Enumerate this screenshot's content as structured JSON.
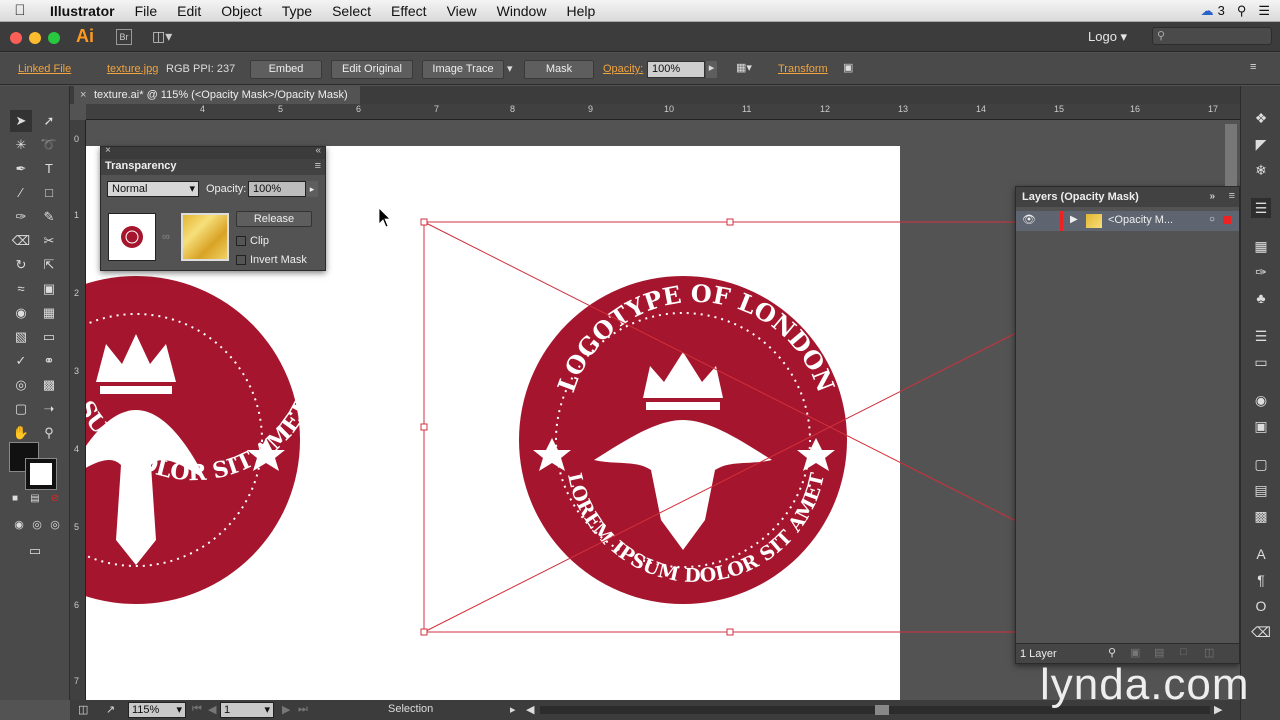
{
  "menubar": {
    "app_name": "Illustrator",
    "items": [
      "File",
      "Edit",
      "Object",
      "Type",
      "Select",
      "Effect",
      "View",
      "Window",
      "Help"
    ],
    "notification_count": "3"
  },
  "appbar": {
    "app_logo": "Ai",
    "bridge": "Br",
    "workspace": "Logo"
  },
  "control_bar": {
    "linked_file": "Linked File",
    "filename": "texture.jpg",
    "color_mode": "RGB",
    "ppi": "PPI: 237",
    "embed": "Embed",
    "edit_original": "Edit Original",
    "image_trace": "Image Trace",
    "mask": "Mask",
    "opacity_label": "Opacity:",
    "opacity_value": "100%",
    "transform": "Transform"
  },
  "document": {
    "tab_title": "texture.ai* @ 115% (<Opacity Mask>/Opacity Mask)"
  },
  "rulers": {
    "h_numbers": [
      "4",
      "5",
      "6",
      "7",
      "8",
      "9",
      "10",
      "11",
      "12",
      "13",
      "14",
      "15",
      "16",
      "17"
    ],
    "v_numbers": [
      "0",
      "1",
      "2",
      "3",
      "4",
      "5",
      "6",
      "7"
    ]
  },
  "artwork": {
    "text_top": "LOGOTYPE OF LONDON",
    "text_bottom": "LOREM IPSUM DOLOR SIT AMET",
    "left_top_fragment": "PE OF LONDON",
    "left_bottom_fragment": "SUM DOLOR SIT AMET",
    "seal_color": "#a5162e"
  },
  "transparency_panel": {
    "title": "Transparency",
    "blend_mode": "Normal",
    "opacity_label": "Opacity:",
    "opacity_value": "100%",
    "release": "Release",
    "clip": "Clip",
    "invert_mask": "Invert Mask"
  },
  "layers_panel": {
    "title": "Layers (Opacity Mask)",
    "row_label": "<Opacity M...",
    "footer": "1 Layer"
  },
  "status_bar": {
    "zoom": "115%",
    "page": "1",
    "tool": "Selection"
  },
  "watermark": "lynda.com"
}
